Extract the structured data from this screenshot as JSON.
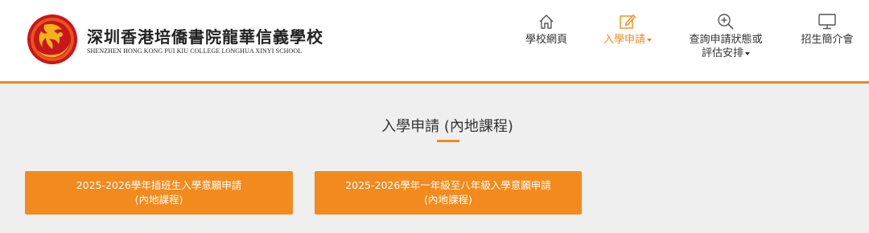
{
  "brand": {
    "name_cn": "深圳香港培僑書院龍華信義學校",
    "name_en": "SHENZHEN HONG KONG PUI KIU COLLEGE LONGHUA XINYI SCHOOL"
  },
  "nav": {
    "items": [
      {
        "label": "學校網頁",
        "icon": "home-icon"
      },
      {
        "label": "入學申請",
        "icon": "edit-icon",
        "active": true
      },
      {
        "label_line1": "查詢申請狀態或",
        "label_line2": "評估安排",
        "icon": "search-plus-icon"
      },
      {
        "label": "招生簡介會",
        "icon": "monitor-icon"
      }
    ]
  },
  "main": {
    "title": "入學申請 (內地課程)",
    "buttons": [
      {
        "line1": "2025-2026學年插班生入學意願申請",
        "line2": "(內地課程)"
      },
      {
        "line1": "2025-2026學年一年級至八年級入學意願申請",
        "line2": "(內地課程)"
      }
    ]
  },
  "colors": {
    "accent": "#f08a1c",
    "background": "#efefef",
    "logo_red": "#c8161d"
  }
}
